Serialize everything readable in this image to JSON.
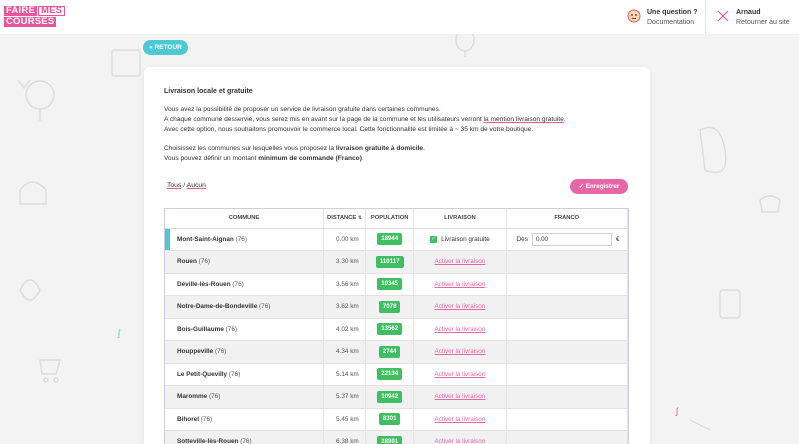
{
  "header": {
    "logo": {
      "line1": [
        "FAIRE",
        "MES"
      ],
      "line2": "COURSES"
    },
    "help": {
      "title": "Une question ?",
      "subtitle": "Documentation"
    },
    "user": {
      "name": "Arnaud",
      "subtitle": "Retourner au site"
    }
  },
  "back_button": "« RETOUR",
  "card": {
    "title": "Livraison locale et gratuite",
    "para1": {
      "line1": "Vous avez la possibilité de proposer un service de livraison gratuite dans certaines communes.",
      "line2_before": "A chaque commune desservie, vous serez mis en avant sur la page de la commune et les utilisateurs verront ",
      "line2_link": "la mention livraison gratuite",
      "line2_after": ".",
      "line3": "Avec cette option, nous souhaitons promouvoir le commerce local. Cette fonctionnalité est limitée à ~ 35 km de votre boutique."
    },
    "para2": {
      "line1_before": "Choisissez les communes sur lesquelles vous proposez la ",
      "line1_bold": "livraison gratuite à domicile",
      "line1_after": ".",
      "line2_before": "Vous pouvez définir un montant ",
      "line2_bold": "minimum de commande (Franco)",
      "line2_after": "."
    },
    "select_all": "Tous",
    "select_sep": " / ",
    "select_none": "Aucun",
    "save_button": "✓ Enregistrer"
  },
  "table": {
    "headers": {
      "commune": "COMMUNE",
      "distance": "DISTANCE",
      "distance_sort": "⇅",
      "population": "POPULATION",
      "livraison": "LIVRAISON",
      "franco": "FRANCO"
    },
    "activate_label": "Activer la livraison",
    "active_label": "Livraison gratuite",
    "franco_prefix": "Dès",
    "franco_value": "0.00",
    "franco_unit": "€",
    "rows": [
      {
        "name": "Mont-Saint-Aignan",
        "dept": "(76)",
        "distance": "0.00 km",
        "population": "18944",
        "active": true
      },
      {
        "name": "Rouen",
        "dept": "(76)",
        "distance": "3.30 km",
        "population": "110117",
        "active": false
      },
      {
        "name": "Déville-lès-Rouen",
        "dept": "(76)",
        "distance": "3.56 km",
        "population": "10345",
        "active": false
      },
      {
        "name": "Notre-Dame-de-Bondeville",
        "dept": "(76)",
        "distance": "3.62 km",
        "population": "7078",
        "active": false
      },
      {
        "name": "Bois-Guillaume",
        "dept": "(76)",
        "distance": "4.02 km",
        "population": "13562",
        "active": false
      },
      {
        "name": "Houppeville",
        "dept": "(76)",
        "distance": "4.34 km",
        "population": "2744",
        "active": false
      },
      {
        "name": "Le Petit-Quevilly",
        "dept": "(76)",
        "distance": "5.14 km",
        "population": "22134",
        "active": false
      },
      {
        "name": "Maromme",
        "dept": "(76)",
        "distance": "5.37 km",
        "population": "10942",
        "active": false
      },
      {
        "name": "Bihorel",
        "dept": "(76)",
        "distance": "5.45 km",
        "population": "8301",
        "active": false
      },
      {
        "name": "Sotteville-lès-Rouen",
        "dept": "(76)",
        "distance": "6.38 km",
        "population": "28991",
        "active": false
      }
    ]
  },
  "colors": {
    "pink": "#e9549a",
    "teal": "#4fc8d6",
    "green": "#3fbf62"
  }
}
